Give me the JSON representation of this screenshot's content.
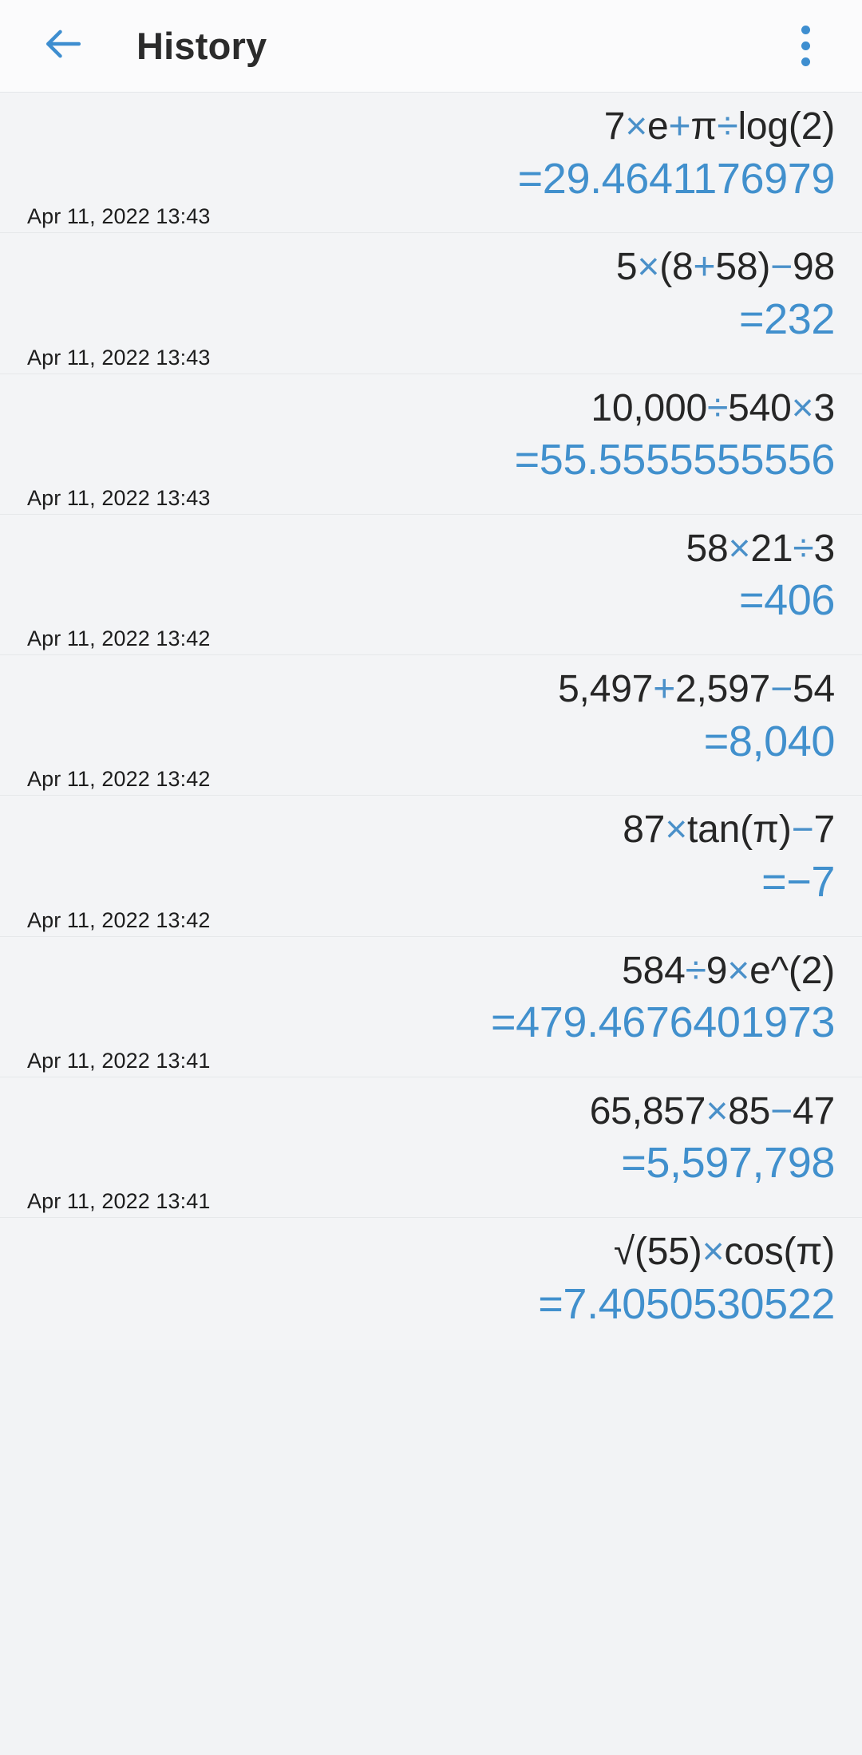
{
  "appbar": {
    "title": "History",
    "back_icon": "arrow-left-icon",
    "overflow_icon": "more-vertical-icon",
    "accent_color": "#3e8ed0"
  },
  "colors": {
    "accent": "#4190cd",
    "operator": "#4a90c9",
    "expression_text": "#262626",
    "row_background": "#f3f4f6",
    "appbar_background": "#fbfbfc",
    "divider": "#e6e8ea"
  },
  "history": [
    {
      "expression": "7×e+π÷log(2)",
      "tokens": [
        {
          "t": "7",
          "op": false
        },
        {
          "t": "×",
          "op": true
        },
        {
          "t": "e",
          "op": false
        },
        {
          "t": "+",
          "op": true
        },
        {
          "t": "π",
          "op": false
        },
        {
          "t": "÷",
          "op": true
        },
        {
          "t": "log(2)",
          "op": false
        }
      ],
      "result": "=29.4641176979",
      "timestamp": "Apr 11, 2022 13:43"
    },
    {
      "expression": "5×(8+58)−98",
      "tokens": [
        {
          "t": "5",
          "op": false
        },
        {
          "t": "×",
          "op": true
        },
        {
          "t": "(8",
          "op": false
        },
        {
          "t": "+",
          "op": true
        },
        {
          "t": "58)",
          "op": false
        },
        {
          "t": "−",
          "op": true
        },
        {
          "t": "98",
          "op": false
        }
      ],
      "result": "=232",
      "timestamp": "Apr 11, 2022 13:43"
    },
    {
      "expression": "10,000÷540×3",
      "tokens": [
        {
          "t": "10,000",
          "op": false
        },
        {
          "t": "÷",
          "op": true
        },
        {
          "t": "540",
          "op": false
        },
        {
          "t": "×",
          "op": true
        },
        {
          "t": "3",
          "op": false
        }
      ],
      "result": "=55.5555555556",
      "timestamp": "Apr 11, 2022 13:43"
    },
    {
      "expression": "58×21÷3",
      "tokens": [
        {
          "t": "58",
          "op": false
        },
        {
          "t": "×",
          "op": true
        },
        {
          "t": "21",
          "op": false
        },
        {
          "t": "÷",
          "op": true
        },
        {
          "t": "3",
          "op": false
        }
      ],
      "result": "=406",
      "timestamp": "Apr 11, 2022 13:42"
    },
    {
      "expression": "5,497+2,597−54",
      "tokens": [
        {
          "t": "5,497",
          "op": false
        },
        {
          "t": "+",
          "op": true
        },
        {
          "t": "2,597",
          "op": false
        },
        {
          "t": "−",
          "op": true
        },
        {
          "t": "54",
          "op": false
        }
      ],
      "result": "=8,040",
      "timestamp": "Apr 11, 2022 13:42"
    },
    {
      "expression": "87×tan(π)−7",
      "tokens": [
        {
          "t": "87",
          "op": false
        },
        {
          "t": "×",
          "op": true
        },
        {
          "t": "tan(π)",
          "op": false
        },
        {
          "t": "−",
          "op": true
        },
        {
          "t": "7",
          "op": false
        }
      ],
      "result": "=−7",
      "timestamp": "Apr 11, 2022 13:42"
    },
    {
      "expression": "584÷9×e^(2)",
      "tokens": [
        {
          "t": "584",
          "op": false
        },
        {
          "t": "÷",
          "op": true
        },
        {
          "t": "9",
          "op": false
        },
        {
          "t": "×",
          "op": true
        },
        {
          "t": "e^(2)",
          "op": false
        }
      ],
      "result": "=479.4676401973",
      "timestamp": "Apr 11, 2022 13:41"
    },
    {
      "expression": "65,857×85−47",
      "tokens": [
        {
          "t": "65,857",
          "op": false
        },
        {
          "t": "×",
          "op": true
        },
        {
          "t": "85",
          "op": false
        },
        {
          "t": "−",
          "op": true
        },
        {
          "t": "47",
          "op": false
        }
      ],
      "result": "=5,597,798",
      "timestamp": "Apr 11, 2022 13:41"
    },
    {
      "expression": "√(55)×cos(π)",
      "tokens": [
        {
          "t": "√(55)",
          "op": false
        },
        {
          "t": "×",
          "op": true
        },
        {
          "t": "cos(π)",
          "op": false
        }
      ],
      "result": "=7.4050530522",
      "timestamp": "",
      "partial": true
    }
  ]
}
